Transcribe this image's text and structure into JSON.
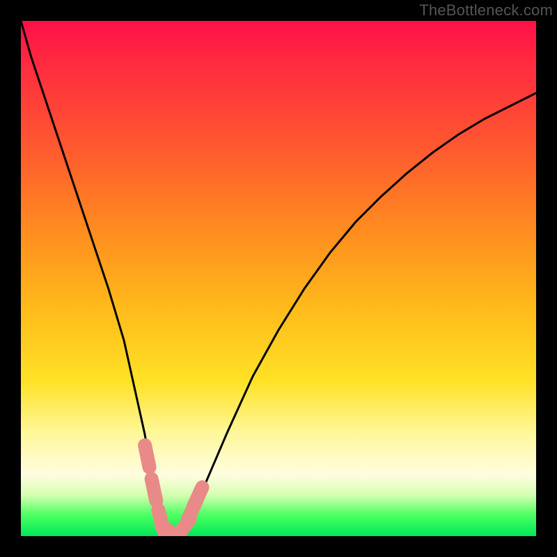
{
  "watermark": "TheBottleneck.com",
  "chart_data": {
    "type": "line",
    "title": "",
    "xlabel": "",
    "ylabel": "",
    "xlim": [
      0,
      100
    ],
    "ylim": [
      0,
      100
    ],
    "grid": false,
    "legend": false,
    "series": [
      {
        "name": "bottleneck-curve",
        "x": [
          0,
          2,
          5,
          8,
          11,
          14,
          17,
          20,
          22,
          24,
          25.5,
          27,
          28,
          29,
          30,
          32,
          34,
          37,
          40,
          45,
          50,
          55,
          60,
          65,
          70,
          75,
          80,
          85,
          90,
          95,
          100
        ],
        "y": [
          100,
          93,
          84,
          75,
          66,
          57,
          48,
          38,
          29,
          20,
          12,
          6,
          2,
          0.5,
          0.5,
          2,
          6,
          13,
          20,
          31,
          40,
          48,
          55,
          61,
          66,
          70.5,
          74.5,
          78,
          81,
          83.5,
          86
        ]
      }
    ],
    "markers": [
      {
        "name": "marker-left",
        "x": 24.5,
        "y": 15.5
      },
      {
        "name": "marker-mid-left",
        "x": 25.8,
        "y": 9.0
      },
      {
        "name": "marker-low-left",
        "x": 27.2,
        "y": 3.0
      },
      {
        "name": "marker-bottom",
        "x": 29.0,
        "y": 0.8
      },
      {
        "name": "marker-low-right",
        "x": 31.5,
        "y": 1.5
      },
      {
        "name": "marker-mid-right-a",
        "x": 33.3,
        "y": 5.2
      },
      {
        "name": "marker-mid-right-b",
        "x": 34.3,
        "y": 7.5
      }
    ],
    "marker_color": "#e98a89",
    "gradient_stops": [
      {
        "pct": 0,
        "color": "#ff1049"
      },
      {
        "pct": 25,
        "color": "#ff5a2f"
      },
      {
        "pct": 55,
        "color": "#ffb81a"
      },
      {
        "pct": 80,
        "color": "#fff79a"
      },
      {
        "pct": 92,
        "color": "#d6ffb2"
      },
      {
        "pct": 100,
        "color": "#00e85a"
      }
    ]
  }
}
